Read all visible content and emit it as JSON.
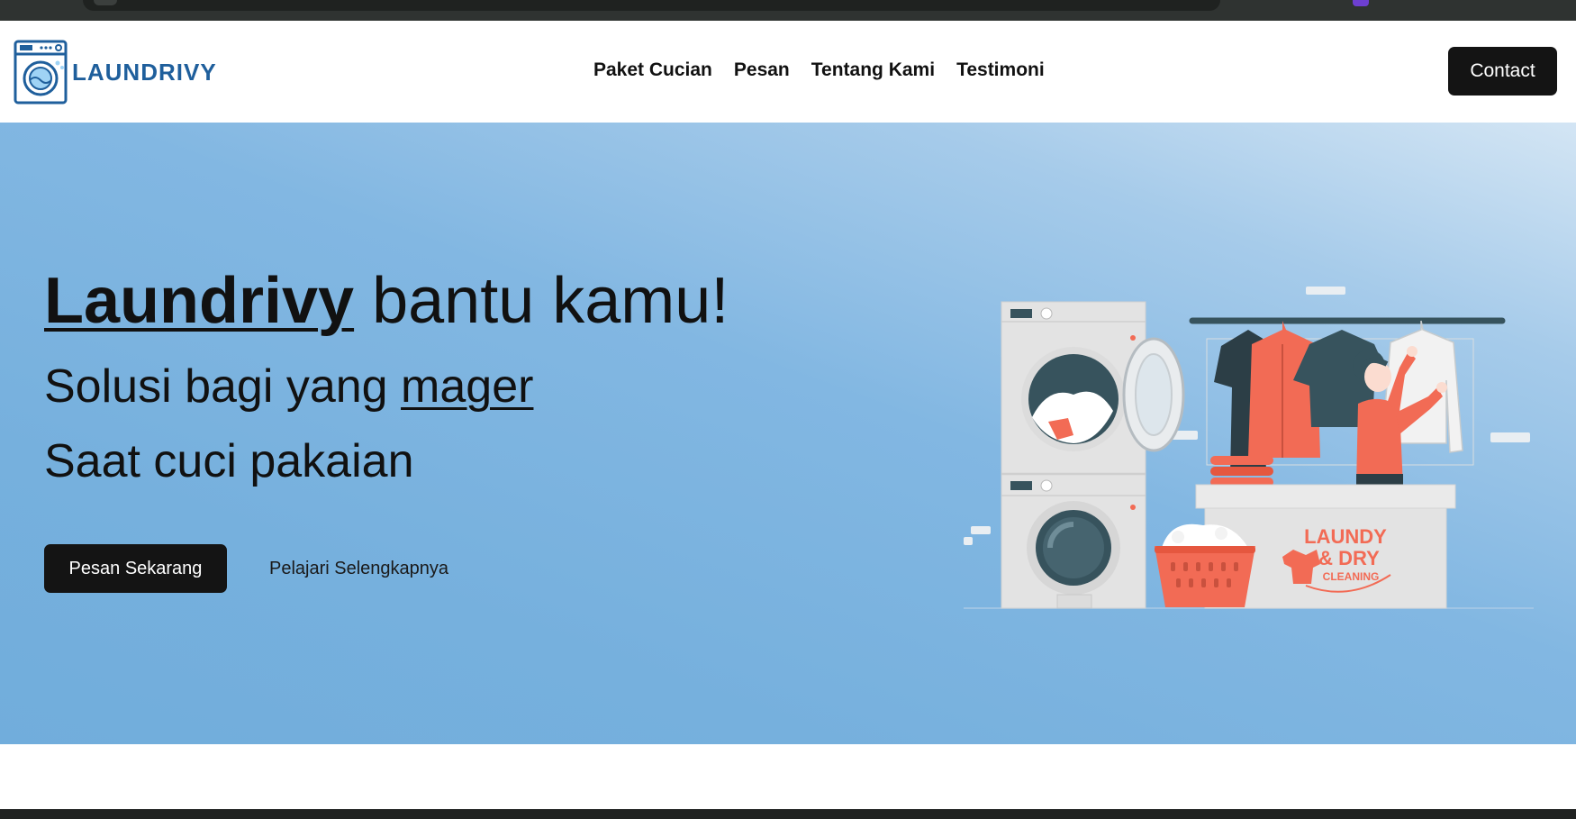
{
  "brand": {
    "name": "LAUNDRIVY",
    "color": "#1f5f9c"
  },
  "nav": {
    "items": [
      {
        "label": "Paket Cucian"
      },
      {
        "label": "Pesan"
      },
      {
        "label": "Tentang Kami"
      },
      {
        "label": "Testimoni"
      }
    ],
    "contact_label": "Contact"
  },
  "hero": {
    "headline_brand": "Laundrivy",
    "headline_rest": " bantu kamu!",
    "subline1_prefix": "Solusi bagi yang ",
    "subline1_emph": "mager",
    "subline2": "Saat cuci pakaian",
    "primary_cta": "Pesan Sekarang",
    "secondary_cta": "Pelajari Selengkapnya",
    "illustration": {
      "sign_line1": "LAUNDY",
      "sign_line2": "& DRY",
      "sign_line3": "CLEANING"
    }
  },
  "colors": {
    "accent": "#f26b55",
    "dark": "#141414",
    "hero_blue": "#76b0dd",
    "machine_grey": "#e3e3e3",
    "drum_dark": "#37535d"
  },
  "icons": [
    "washing-machine-logo-icon"
  ]
}
